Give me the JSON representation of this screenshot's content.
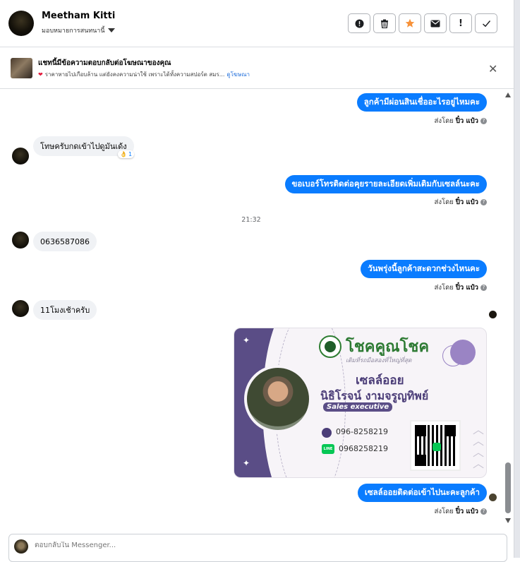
{
  "header": {
    "name": "Meetham Kitti",
    "assign": "มอบหมายการสนทนานี้",
    "tools": [
      {
        "icon": "alert-circle-icon",
        "glyph": "!"
      },
      {
        "icon": "trash-icon",
        "glyph": "🗑"
      },
      {
        "icon": "star-icon",
        "glyph": "★"
      },
      {
        "icon": "envelope-icon",
        "glyph": "✉"
      },
      {
        "icon": "exclamation-icon",
        "glyph": "!"
      },
      {
        "icon": "check-icon",
        "glyph": "✓"
      }
    ]
  },
  "ad": {
    "title": "แชทนี้มีข้อความตอบกลับต่อโฆษณาของคุณ",
    "preview": "ราคาหายไปเกือบล้าน แต่ยังคงความน่าใช้ เพราะได้ทั้งความสปอร์ต สมร...",
    "link": "ดูโฆษณา",
    "close": "✕"
  },
  "messages": [
    {
      "dir": "out",
      "text": "ลูกค้ามีผ่อนสินเชื่ออะไรอยู่ไหมคะ",
      "sent_prefix": "ส่งโดย",
      "sent_by": "ปิ๋ว แป๋ว"
    },
    {
      "dir": "in",
      "text": "โทษครับกดเข้าไปดูมันเด้ง",
      "reaction": "👌",
      "reaction_count": "1"
    },
    {
      "dir": "out",
      "text": "ขอเบอร์โทรติดต่อคุยรายละเอียดเพิ่มเติมกับเซลล์นะคะ",
      "sent_prefix": "ส่งโดย",
      "sent_by": "ปิ๋ว แป๋ว"
    },
    {
      "dir": "time",
      "text": "21:32"
    },
    {
      "dir": "in",
      "text": "0636587086"
    },
    {
      "dir": "out",
      "text": "วันพรุ่งนี้ลูกค้าสะดวกช่วงไหนคะ",
      "sent_prefix": "ส่งโดย",
      "sent_by": "ปิ๋ว แป๋ว"
    },
    {
      "dir": "in",
      "text": "11โมงเช้าครับ"
    },
    {
      "dir": "out",
      "text": "เซลล์ออยติดต่อเข้าไปนะคะลูกค้า",
      "sent_prefix": "ส่งโดย",
      "sent_by": "ปิ๋ว แป๋ว"
    }
  ],
  "card": {
    "brand": "โชคคูณโชค",
    "tagline": "เติมที่รถมือสองที่ใหญ่ที่สุด",
    "nickname": "เซลล์ออย",
    "fullname": "นิธิโรจน์  งามจรูญทิพย์",
    "role": "Sales executive",
    "phone": "096-8258219",
    "line_label": "LINE",
    "line_id": "0968258219"
  },
  "composer": {
    "placeholder": "ตอบกลับใน Messenger..."
  }
}
